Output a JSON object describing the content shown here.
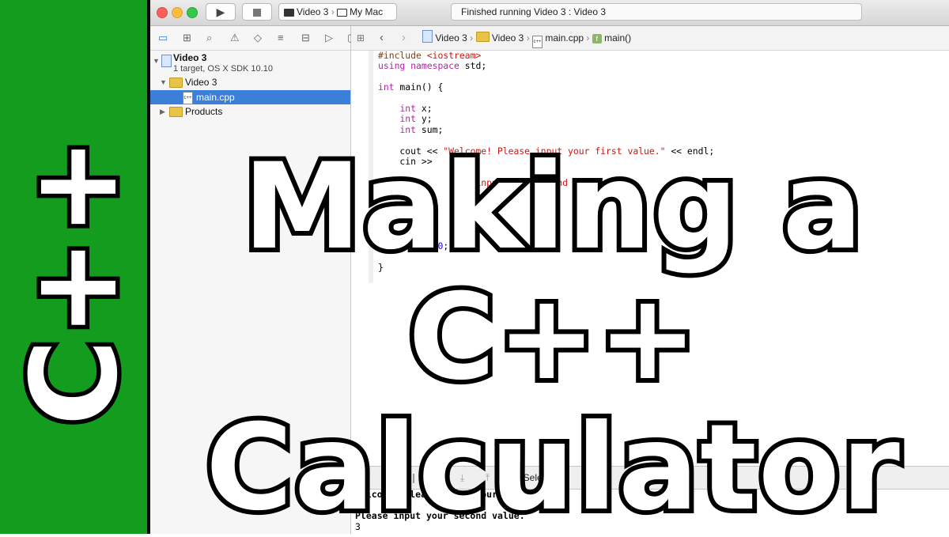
{
  "banner": {
    "text": "C++"
  },
  "toolbar": {
    "scheme_target": "Video 3",
    "scheme_device": "My Mac",
    "status": "Finished running Video 3 : Video 3"
  },
  "navigator": {
    "project_name": "Video 3",
    "project_subtitle": "1 target, OS X SDK 10.10",
    "group_name": "Video 3",
    "file_name": "main.cpp",
    "products": "Products"
  },
  "jumpbar": {
    "crumbs": [
      "Video 3",
      "Video 3",
      "main.cpp",
      "main()"
    ]
  },
  "editor": {
    "lines": [
      "#include <iostream>",
      "using namespace std;",
      "",
      "int main() {",
      "",
      "    int x;",
      "    int y;",
      "    int sum;",
      "",
      "    cout << \"Welcome! Please input your first value.\" << endl;",
      "    cin >>",
      "",
      "                  input your second value.\" <<",
      "",
      "          =",
      "",
      "          i",
      "",
      "    return 0;",
      "",
      "}"
    ]
  },
  "debug": {
    "selection": "No Selection"
  },
  "console": {
    "lines": [
      "Welcome! Please input your first value.",
      "5",
      "Please input your second value.",
      "3"
    ]
  },
  "title": {
    "line1": "Making a C++",
    "line2": "Calculator"
  },
  "colors": {
    "banner_green": "#149c1e",
    "selection_blue": "#3b7fd9",
    "keyword": "#b326a8",
    "string": "#c41a16"
  }
}
